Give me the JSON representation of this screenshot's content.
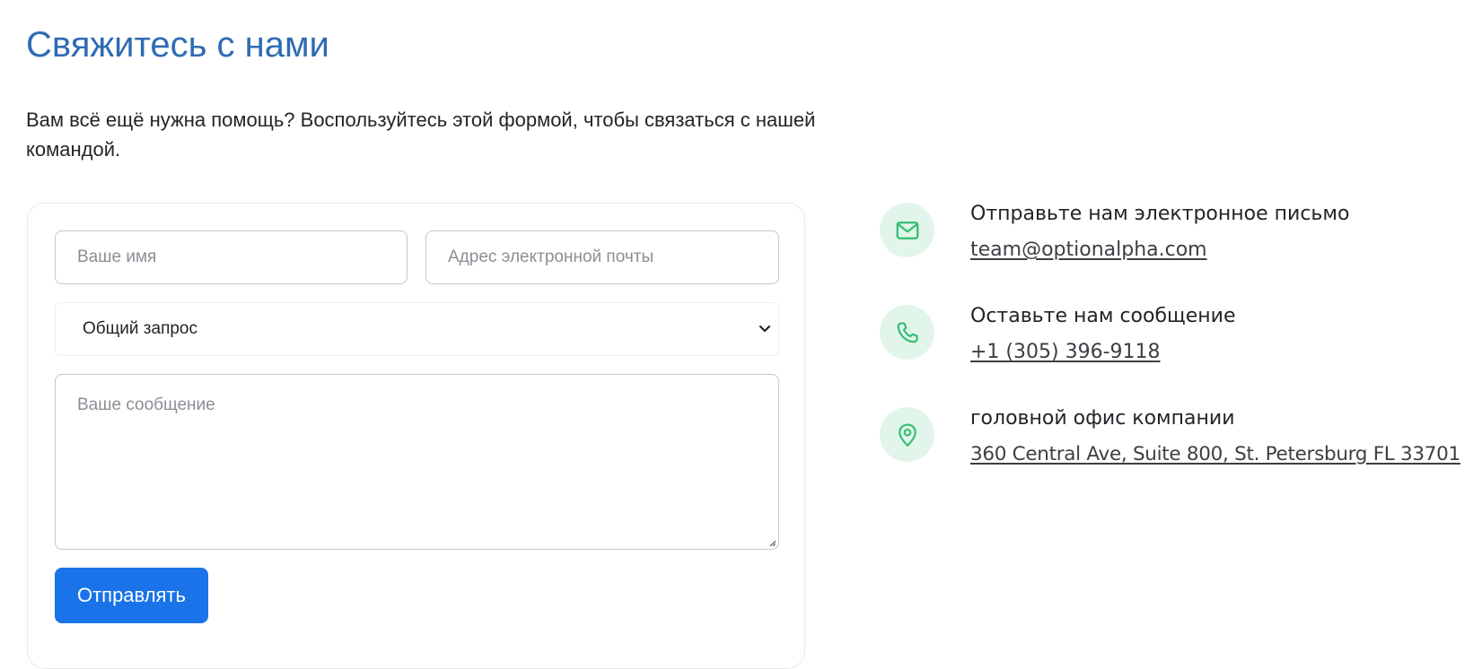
{
  "header": {
    "title": "Свяжитесь с нами",
    "intro": "Вам всё ещё нужна помощь? Воспользуйтесь этой формой, чтобы связаться с нашей командой."
  },
  "form": {
    "name_placeholder": "Ваше имя",
    "email_placeholder": "Адрес электронной почты",
    "subject_selected": "Общий запрос",
    "message_placeholder": "Ваше сообщение",
    "submit_label": "Отправлять"
  },
  "contacts": [
    {
      "icon": "mail-icon",
      "title": "Отправьте нам электронное письмо",
      "value": "team@optionalpha.com"
    },
    {
      "icon": "phone-icon",
      "title": "Оставьте нам сообщение",
      "value": "+1 (305) 396-9118"
    },
    {
      "icon": "location-pin-icon",
      "title": "головной офис компании",
      "value": "360 Central Ave, Suite 800, St. Petersburg FL 33701"
    }
  ],
  "colors": {
    "title": "#2f6bb3",
    "button": "#1a73e8",
    "icon_bg": "#e2f5ea",
    "icon_stroke": "#2fbf71"
  }
}
